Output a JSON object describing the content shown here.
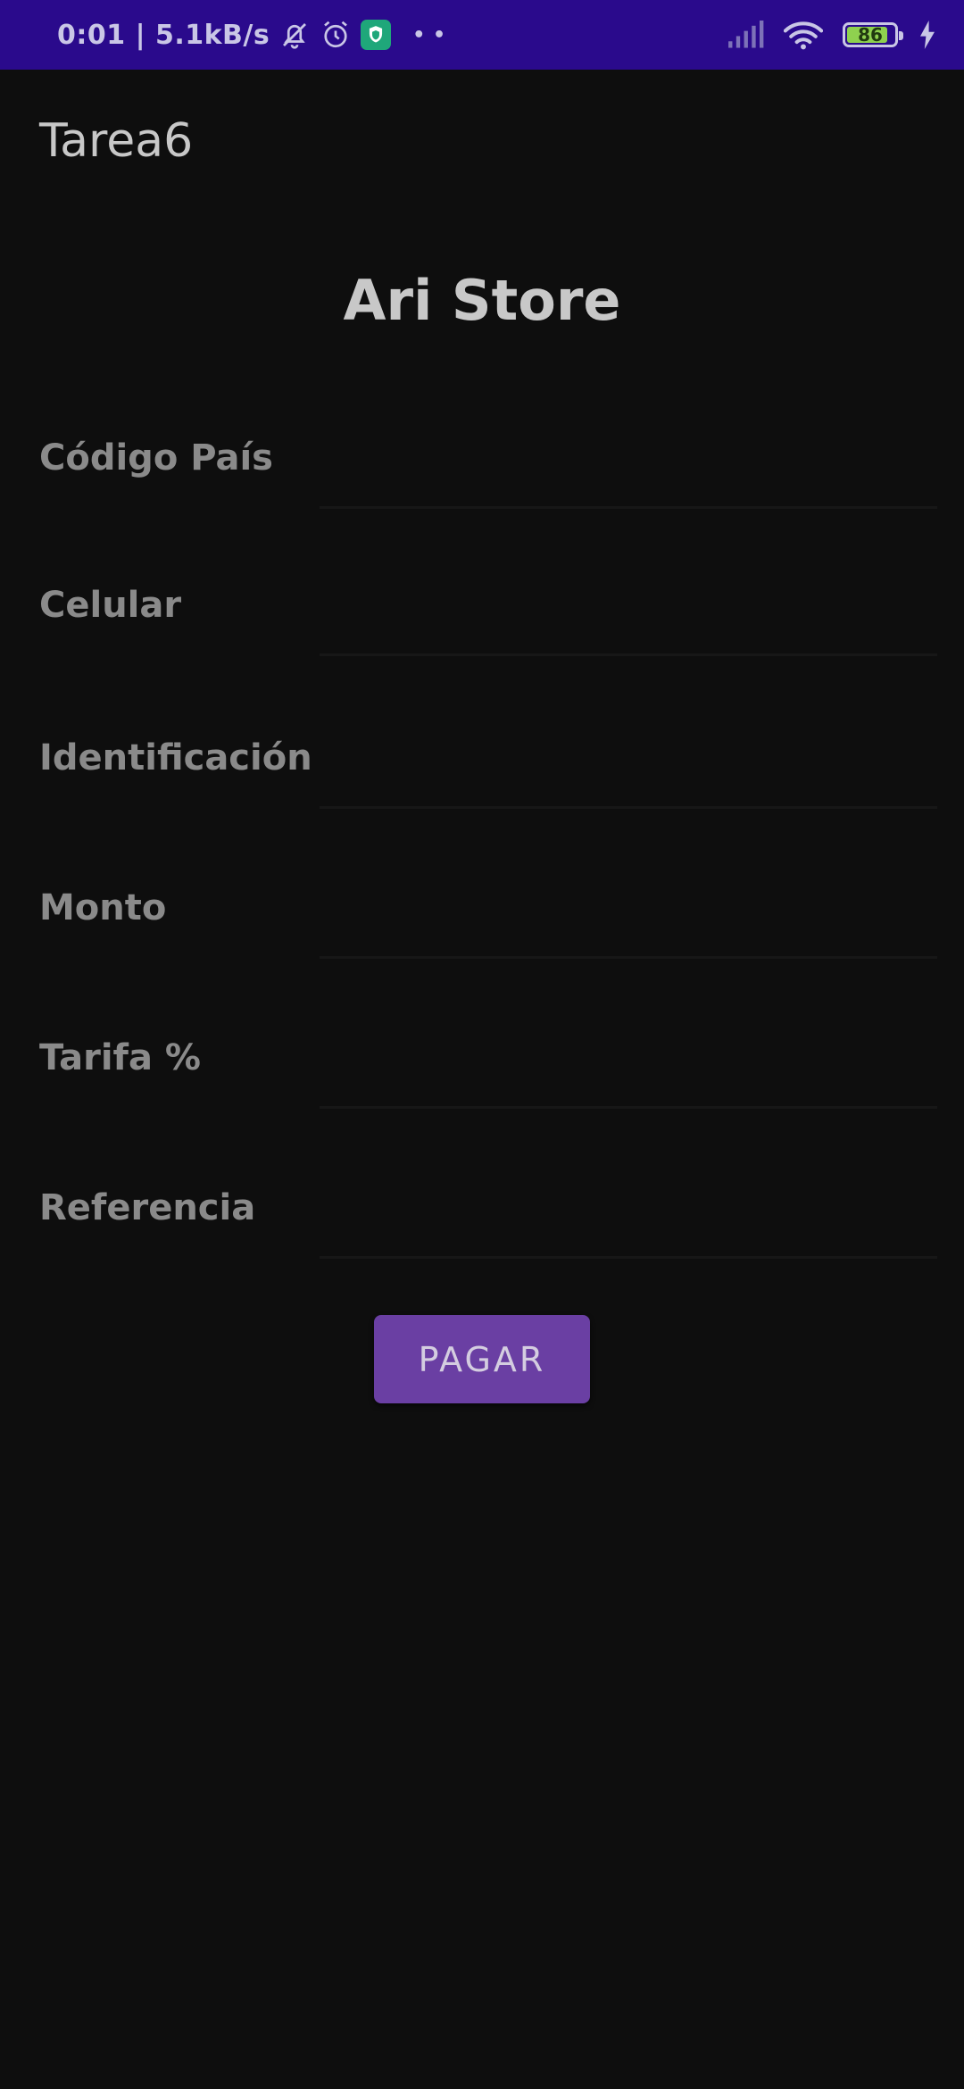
{
  "status_bar": {
    "time_speed": "0:01 | 5.1kB/s",
    "more_dots": "• •",
    "battery_level": "86",
    "battery_fraction": 0.86
  },
  "app_bar": {
    "title": "Tarea6"
  },
  "store": {
    "title": "Ari Store"
  },
  "form": {
    "fields": [
      {
        "label": "Código País",
        "value": ""
      },
      {
        "label": "Celular",
        "value": ""
      },
      {
        "label": "Identificación",
        "value": ""
      },
      {
        "label": "Monto",
        "value": ""
      },
      {
        "label": "Tarifa %",
        "value": ""
      },
      {
        "label": "Referencia",
        "value": ""
      }
    ]
  },
  "actions": {
    "pay_label": "PAGAR"
  },
  "colors": {
    "status_bar": "#2a0a8c",
    "background": "#0e0e0e",
    "button": "#6a3fa3",
    "battery_fill": "#8fd14f",
    "shield_app": "#1fa77a"
  },
  "icons": {
    "status_left": [
      "bell-off-icon",
      "alarm-icon",
      "shield-app-icon"
    ],
    "status_right": [
      "signal-icon",
      "wifi-icon",
      "battery-icon",
      "charging-bolt-icon"
    ]
  }
}
